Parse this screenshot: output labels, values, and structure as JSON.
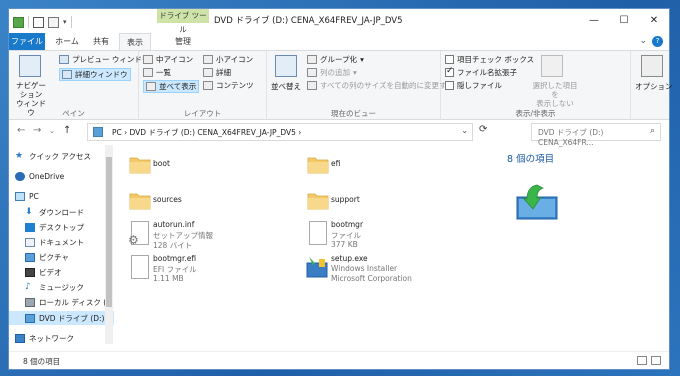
{
  "window": {
    "title": "DVD ドライブ (D:) CENA_X64FREV_JA-JP_DV5",
    "context_tab_label": "ドライブ ツール",
    "controls": {
      "minimize": "—",
      "maximize": "☐",
      "close": "✕"
    }
  },
  "tabs": [
    {
      "label": "ファイル"
    },
    {
      "label": "ホーム"
    },
    {
      "label": "共有"
    },
    {
      "label": "表示"
    },
    {
      "label": "管理"
    }
  ],
  "ribbon": {
    "pane_group": {
      "label": "ペイン",
      "nav_pane": "ナビゲーション\nウィンドウ",
      "preview_pane": "プレビュー ウィンドウ",
      "details_pane": "詳細ウィンドウ"
    },
    "layout_group": {
      "label": "レイアウト",
      "items": [
        "中アイコン",
        "小アイコン",
        "一覧",
        "詳細",
        "並べて表示",
        "コンテンツ"
      ]
    },
    "current_view_group": {
      "label": "現在のビュー",
      "sort": "並べ替え",
      "group_by": "グループ化",
      "add_column": "列の追加",
      "fit_columns": "すべての列のサイズを自動的に変更する"
    },
    "show_hide_group": {
      "label": "表示/非表示",
      "item_checkboxes": "項目チェック ボックス",
      "file_extensions": "ファイル名拡張子",
      "hidden_items": "隠しファイル",
      "hide_selected": "選択した項目を\n表示しない",
      "options": "オプション"
    }
  },
  "address": {
    "path": "PC  ›  DVD ドライブ (D:) CENA_X64FREV_JA-JP_DV5  ›",
    "search_placeholder": "DVD ドライブ (D:) CENA_X64FR..."
  },
  "nav_pane": {
    "items": [
      {
        "label": "クイック アクセス",
        "icon": "star-icon"
      },
      {
        "label": "OneDrive",
        "icon": "cloud-icon"
      },
      {
        "label": "PC",
        "icon": "pc-icon"
      },
      {
        "label": "ダウンロード",
        "icon": "download-icon"
      },
      {
        "label": "デスクトップ",
        "icon": "desktop-icon"
      },
      {
        "label": "ドキュメント",
        "icon": "document-icon"
      },
      {
        "label": "ピクチャ",
        "icon": "picture-icon"
      },
      {
        "label": "ビデオ",
        "icon": "video-icon"
      },
      {
        "label": "ミュージック",
        "icon": "music-icon"
      },
      {
        "label": "ローカル ディスク (C:)",
        "icon": "disk-icon"
      },
      {
        "label": "DVD ドライブ (D:) C",
        "icon": "dvd-icon"
      },
      {
        "label": "ネットワーク",
        "icon": "network-icon"
      }
    ]
  },
  "files": [
    {
      "name": "boot",
      "type": "",
      "size": "",
      "icon": "folder-icon"
    },
    {
      "name": "efi",
      "type": "",
      "size": "",
      "icon": "folder-icon"
    },
    {
      "name": "sources",
      "type": "",
      "size": "",
      "icon": "folder-icon"
    },
    {
      "name": "support",
      "type": "",
      "size": "",
      "icon": "folder-icon"
    },
    {
      "name": "autorun.inf",
      "type": "セットアップ情報",
      "size": "128 バイト",
      "icon": "setup-info-icon"
    },
    {
      "name": "bootmgr",
      "type": "ファイル",
      "size": "377 KB",
      "icon": "file-icon"
    },
    {
      "name": "bootmgr.efi",
      "type": "EFI ファイル",
      "size": "1.11 MB",
      "icon": "file-icon"
    },
    {
      "name": "setup.exe",
      "type": "Windows Installer",
      "size": "Microsoft Corporation",
      "icon": "installer-icon"
    }
  ],
  "preview": {
    "count": "8 個の項目"
  },
  "status": {
    "count": "8 個の項目"
  }
}
